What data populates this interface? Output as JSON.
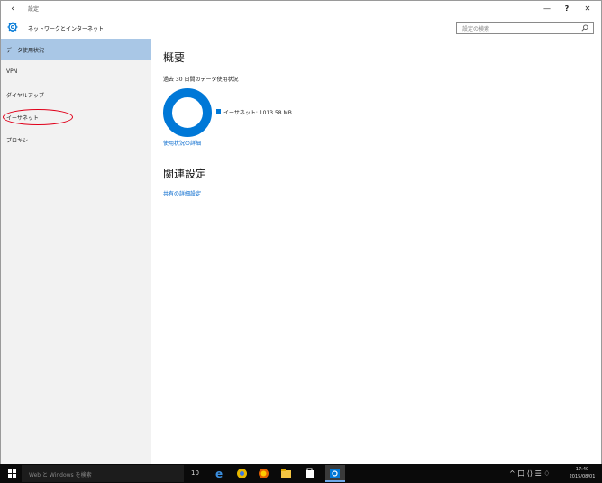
{
  "window": {
    "back_glyph": "‹",
    "title": "設定",
    "minimize_glyph": "—",
    "maximize_glyph": "?",
    "close_glyph": "✕"
  },
  "header": {
    "page_title": "ネットワークとインターネット",
    "search_placeholder": "設定の検索",
    "icon": "gear-icon"
  },
  "sidebar": {
    "items": [
      {
        "label": "データ使用状況",
        "active": true
      },
      {
        "label": "VPN",
        "active": false
      },
      {
        "label": "ダイヤルアップ",
        "active": false
      },
      {
        "label": "イーサネット",
        "active": false
      },
      {
        "label": "プロキシ",
        "active": false
      }
    ],
    "highlighted_index": 3
  },
  "main": {
    "overview_heading": "概要",
    "usage_caption": "過去 30 日間のデータ使用状況",
    "legend_label": "イーサネット: 1013.58 MB",
    "usage_details_link": "使用状況の詳細",
    "related_heading": "関連設定",
    "sharing_link": "共有の詳細設定"
  },
  "chart_data": {
    "type": "pie",
    "categories": [
      "イーサネット"
    ],
    "values": [
      1013.58
    ],
    "unit": "MB",
    "donut": true
  },
  "taskbar": {
    "search_placeholder": "Web と Windows を検索",
    "ime": "10",
    "tray_glyphs": "^ 口 ⟨⟩ ☰ ♢",
    "clock_time": "17:40",
    "clock_date": "2015/08/01"
  },
  "colors": {
    "accent": "#0078d7",
    "sidebar_active": "#a9c7e6",
    "link": "#0066cc",
    "annotation": "#e0001a",
    "taskbar": "#0a0a0a"
  }
}
